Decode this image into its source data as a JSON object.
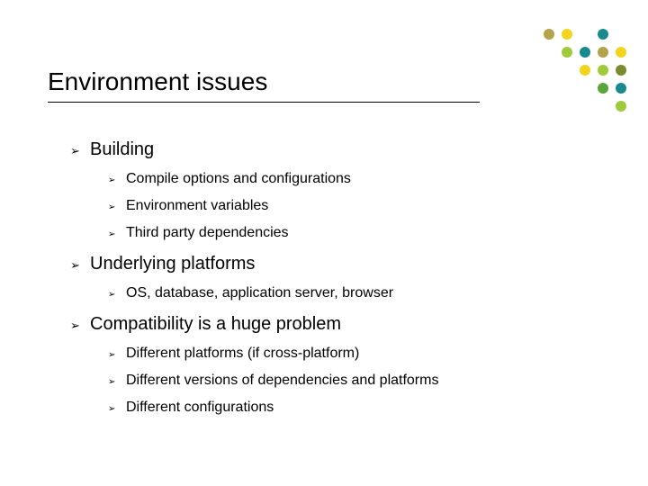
{
  "title": "Environment issues",
  "slide": {
    "items": [
      {
        "text": "Building",
        "children": [
          {
            "text": "Compile options and configurations"
          },
          {
            "text": "Environment variables"
          },
          {
            "text": "Third party dependencies"
          }
        ]
      },
      {
        "text": "Underlying platforms",
        "children": [
          {
            "text": "OS, database, application server, browser"
          }
        ]
      },
      {
        "text": "Compatibility is a huge problem",
        "children": [
          {
            "text": "Different platforms (if cross-platform)"
          },
          {
            "text": "Different versions of dependencies and platforms"
          },
          {
            "text": "Different configurations"
          }
        ]
      }
    ]
  },
  "dot_colors": {
    "khaki": "#b3a24c",
    "yellow": "#f2d41f",
    "teal": "#1a8a8f",
    "lime": "#9fcb3b",
    "olive": "#7a8a2e",
    "green": "#5aa63a"
  }
}
